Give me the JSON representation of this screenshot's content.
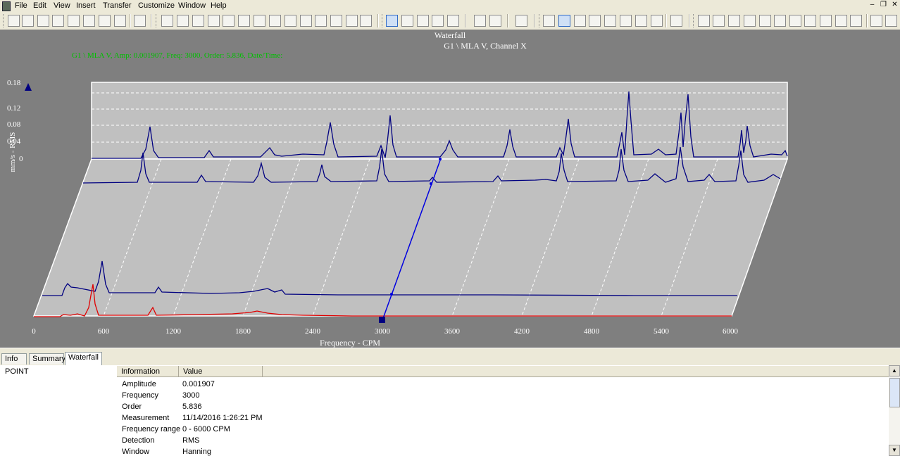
{
  "menu": [
    "File",
    "Edit",
    "View",
    "Insert",
    "Transfer",
    "Customize",
    "Window",
    "Help"
  ],
  "window_controls": {
    "minimize": "–",
    "restore": "❐",
    "close": "✕"
  },
  "plot": {
    "title": "Waterfall",
    "subtitle": "G1 \\ MLA V, Channel X",
    "cursor_info": "G1 \\ MLA V, Amp: 0.001907, Freq: 3000, Order: 5.836, Date/Time:",
    "ylabel": "mm/s - RMS",
    "xlabel": "Frequency - CPM",
    "yticks": [
      "0.18",
      "0.12",
      "0.08",
      "0.04",
      "0"
    ],
    "xticks": [
      "0",
      "600",
      "1200",
      "1800",
      "2400",
      "3000",
      "3600",
      "4200",
      "4800",
      "5400",
      "6000"
    ],
    "colors": {
      "background": "#7f7f7f",
      "floor": "#c0c0c0",
      "spectrum": "#000080",
      "selected_spectrum": "#e00000",
      "cursor": "#0000e0",
      "cursor_info": "#00c000"
    }
  },
  "tabs": [
    "Info",
    "Summary",
    "Waterfall"
  ],
  "active_tab": "Waterfall",
  "info_table": {
    "columns": [
      "Information",
      "Value"
    ],
    "point_label": "POINT",
    "rows": [
      {
        "name": "Amplitude",
        "value": "0.001907"
      },
      {
        "name": "Frequency",
        "value": "3000"
      },
      {
        "name": "Order",
        "value": "5.836"
      },
      {
        "name": "Measurement",
        "value": "11/14/2016 1:26:21 PM"
      },
      {
        "name": "Frequency range",
        "value": "0 - 6000 CPM"
      },
      {
        "name": "Detection",
        "value": "RMS"
      },
      {
        "name": "Window",
        "value": "Hanning"
      }
    ]
  }
}
